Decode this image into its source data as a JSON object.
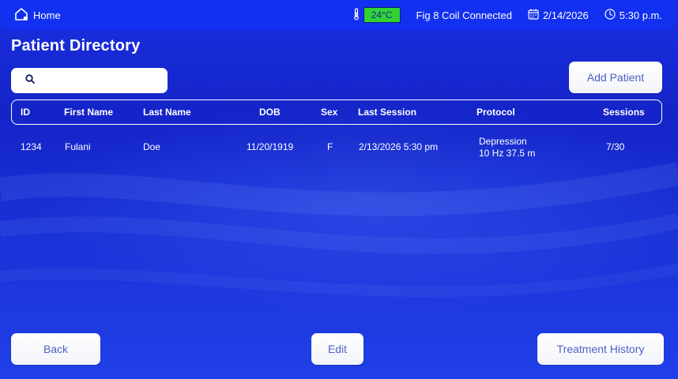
{
  "header": {
    "home_label": "Home",
    "temperature": "24°C",
    "coil_status": "Fig 8 Coil Connected",
    "date": "2/14/2026",
    "time": "5:30 p.m."
  },
  "page": {
    "title": "Patient Directory"
  },
  "search": {
    "value": "",
    "placeholder": ""
  },
  "actions": {
    "add_patient": "Add Patient",
    "back": "Back",
    "edit": "Edit",
    "treatment_history": "Treatment History"
  },
  "table": {
    "columns": {
      "id": "ID",
      "first_name": "First Name",
      "last_name": "Last Name",
      "dob": "DOB",
      "sex": "Sex",
      "last_session": "Last Session",
      "protocol": "Protocol",
      "sessions": "Sessions"
    },
    "rows": [
      {
        "id": "1234",
        "first_name": "Fulani",
        "last_name": "Doe",
        "dob": "11/20/1919",
        "sex": "F",
        "last_session": "2/13/2026 5:30 pm",
        "protocol_name": "Depression",
        "protocol_params": "10 Hz 37.5 m",
        "sessions": "7/30"
      }
    ]
  },
  "colors": {
    "background": "#1424c8",
    "topbar": "#1230f0",
    "temperature_badge": "#33d233",
    "button_text": "#4f61c4"
  },
  "icons": {
    "home": "home-icon",
    "thermometer": "thermometer-icon",
    "calendar": "calendar-icon",
    "clock": "clock-icon",
    "search": "search-icon"
  }
}
